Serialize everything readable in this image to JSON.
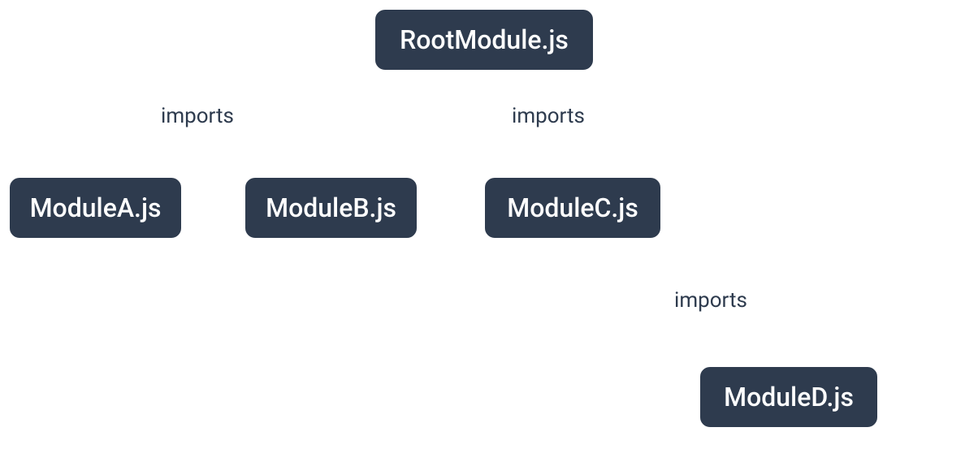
{
  "nodes": {
    "root": "RootModule.js",
    "a": "ModuleA.js",
    "b": "ModuleB.js",
    "c": "ModuleC.js",
    "d": "ModuleD.js"
  },
  "edges": {
    "root_a": "imports",
    "root_c": "imports",
    "c_d": "imports"
  }
}
